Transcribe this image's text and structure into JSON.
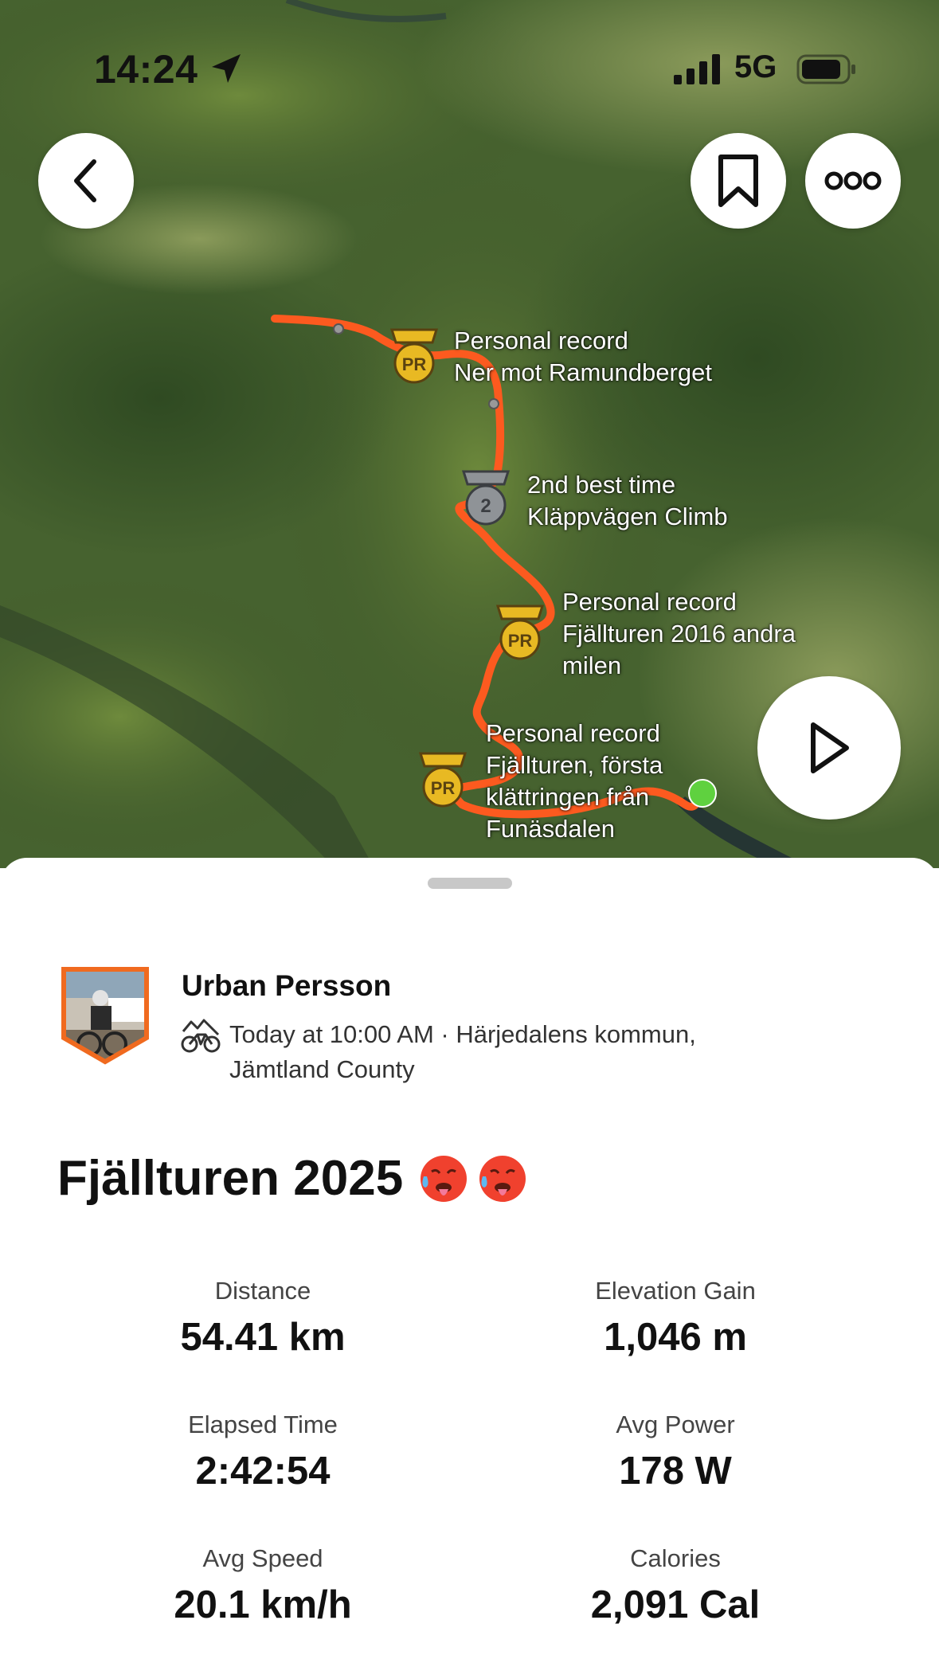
{
  "status_bar": {
    "time": "14:24",
    "network": "5G"
  },
  "map": {
    "route_color": "#fc5a1f",
    "segments": [
      {
        "label_line1": "Personal record",
        "label_line2": "Ner mot Ramundberget",
        "label_line3": "",
        "medal": "PR"
      },
      {
        "label_line1": "2nd best time",
        "label_line2": "Kläppvägen Climb",
        "label_line3": "",
        "medal": "2"
      },
      {
        "label_line1": "Personal record",
        "label_line2": "Fjällturen 2016 andra",
        "label_line3": "milen",
        "medal": "PR"
      },
      {
        "label_line1": "Personal record",
        "label_line2": "Fjällturen, första",
        "label_line3": "klättringen från",
        "label_line4": "Funäsdalen",
        "medal": "PR"
      }
    ]
  },
  "athlete": {
    "name": "Urban Persson",
    "meta_line1": "Today at 10:00 AM · Härjedalens kommun,",
    "meta_line2": "Jämtland County"
  },
  "activity": {
    "title": "Fjällturen 2025"
  },
  "stats": {
    "distance_label": "Distance",
    "distance_value": "54.41 km",
    "elevation_label": "Elevation Gain",
    "elevation_value": "1,046 m",
    "elapsed_label": "Elapsed Time",
    "elapsed_value": "2:42:54",
    "power_label": "Avg Power",
    "power_value": "178 W",
    "speed_label": "Avg Speed",
    "speed_value": "20.1 km/h",
    "calories_label": "Calories",
    "calories_value": "2,091 Cal"
  }
}
